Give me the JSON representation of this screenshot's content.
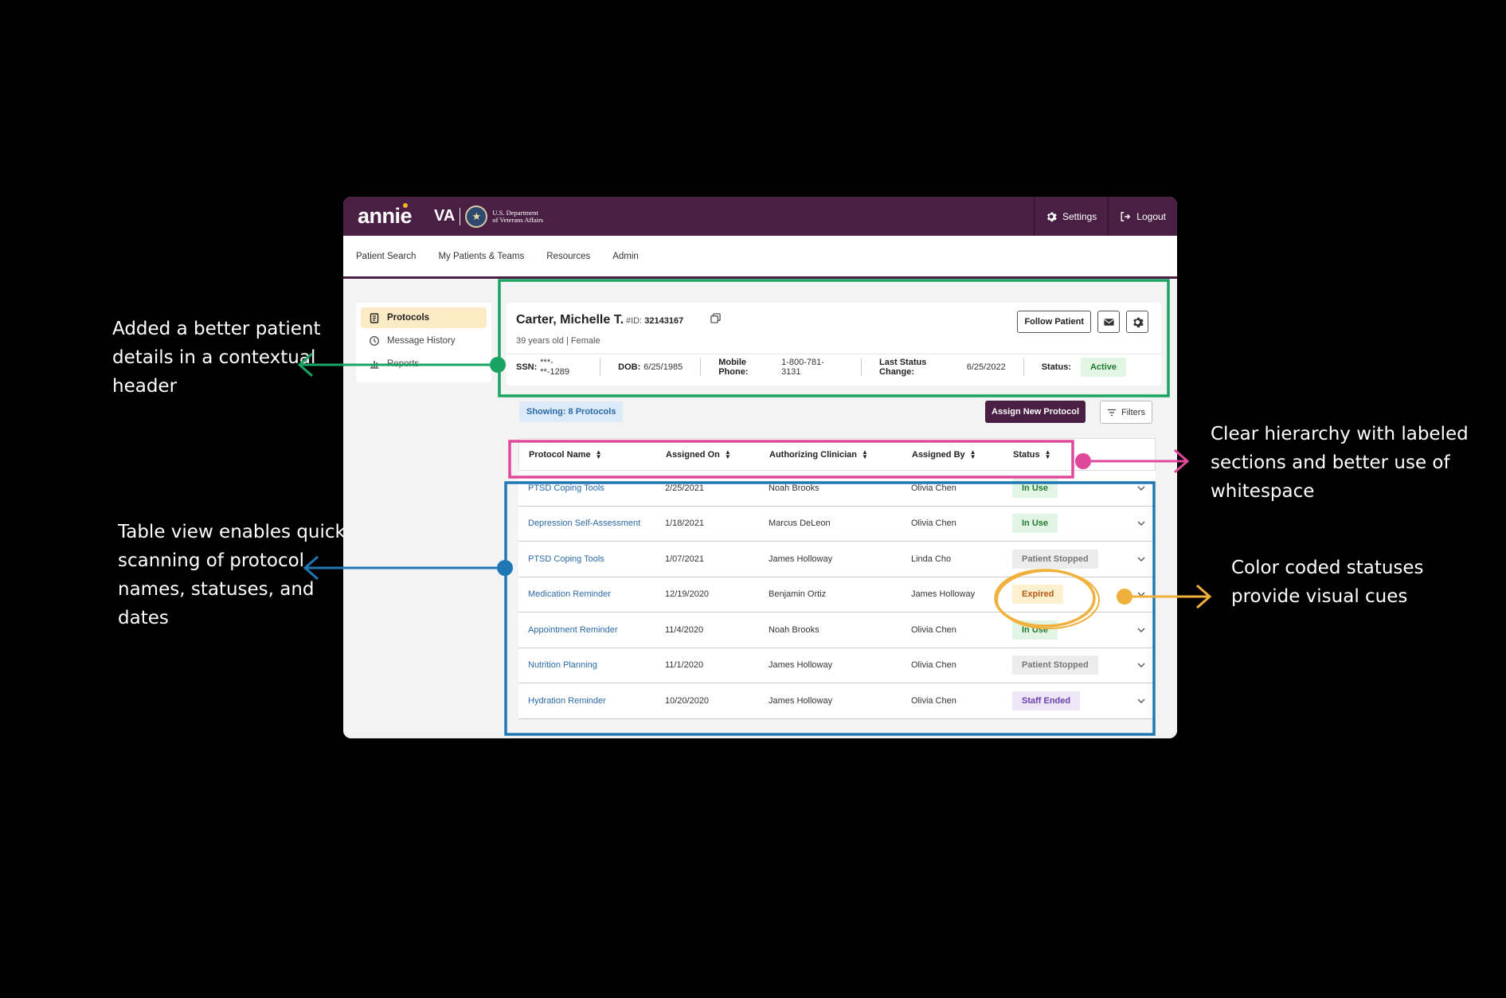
{
  "annotations": {
    "patient_header": "Added a better patient details in a contextual header",
    "table_view": "Table view enables quick scanning of protocol names, statuses, and dates",
    "hierarchy": "Clear hierarchy with labeled sections and better use of whitespace",
    "status_colors": "Color coded statuses provide visual cues"
  },
  "colors": {
    "green": "#1aa463",
    "pink": "#e0489b",
    "blue": "#1f78b4",
    "yellow": "#f0b13c",
    "brand": "#4a1f44"
  },
  "topbar": {
    "logo": "annie",
    "va": "VA",
    "dept_line1": "U.S. Department",
    "dept_line2": "of Veterans Affairs",
    "settings": "Settings",
    "logout": "Logout"
  },
  "nav": {
    "items": [
      "Patient Search",
      "My Patients & Teams",
      "Resources",
      "Admin"
    ]
  },
  "sidebar": {
    "items": [
      {
        "label": "Protocols",
        "icon": "clipboard-icon",
        "active": true
      },
      {
        "label": "Message History",
        "icon": "history-icon",
        "active": false
      },
      {
        "label": "Reports",
        "icon": "chart-icon",
        "active": false
      }
    ]
  },
  "patient": {
    "name": "Carter, Michelle T.",
    "id_label": "#ID:",
    "id_value": "32143167",
    "subtitle": "39 years old | Female",
    "follow_label": "Follow Patient",
    "ssn_label": "SSN:",
    "ssn_value": "***-**-1289",
    "dob_label": "DOB:",
    "dob_value": "6/25/1985",
    "phone_label": "Mobile Phone:",
    "phone_value": "1-800-781-3131",
    "last_change_label": "Last Status Change:",
    "last_change_value": "6/25/2022",
    "status_label": "Status:",
    "status_value": "Active"
  },
  "toolbar": {
    "showing": "Showing: 8 Protocols",
    "assign": "Assign New Protocol",
    "filters": "Filters"
  },
  "table": {
    "headers": [
      "Protocol Name",
      "Assigned On",
      "Authorizing Clinician",
      "Assigned By",
      "Status"
    ],
    "rows": [
      {
        "name": "PTSD Coping Tools",
        "assigned_on": "2/25/2021",
        "clinician": "Noah Brooks",
        "assigned_by": "Olivia Chen",
        "status": "In Use",
        "status_type": "inuse"
      },
      {
        "name": "Depression Self-Assessment",
        "assigned_on": "1/18/2021",
        "clinician": "Marcus DeLeon",
        "assigned_by": "Olivia Chen",
        "status": "In Use",
        "status_type": "inuse"
      },
      {
        "name": "PTSD Coping Tools",
        "assigned_on": "1/07/2021",
        "clinician": "James Holloway",
        "assigned_by": "Linda Cho",
        "status": "Patient Stopped",
        "status_type": "stopped"
      },
      {
        "name": "Medication Reminder",
        "assigned_on": "12/19/2020",
        "clinician": "Benjamin Ortiz",
        "assigned_by": "James Holloway",
        "status": "Expired",
        "status_type": "expired"
      },
      {
        "name": "Appointment Reminder",
        "assigned_on": "11/4/2020",
        "clinician": "Noah Brooks",
        "assigned_by": "Olivia Chen",
        "status": "In Use",
        "status_type": "inuse"
      },
      {
        "name": "Nutrition Planning",
        "assigned_on": "11/1/2020",
        "clinician": "James Holloway",
        "assigned_by": "Olivia Chen",
        "status": "Patient Stopped",
        "status_type": "stopped"
      },
      {
        "name": "Hydration Reminder",
        "assigned_on": "10/20/2020",
        "clinician": "James Holloway",
        "assigned_by": "Olivia Chen",
        "status": "Staff Ended",
        "status_type": "ended"
      }
    ]
  },
  "status_styles": {
    "inuse": {
      "bg": "#e2f4e3",
      "fg": "#1f7a32"
    },
    "stopped": {
      "bg": "#ececec",
      "fg": "#777777"
    },
    "expired": {
      "bg": "#fdf0cf",
      "fg": "#b55a12"
    },
    "ended": {
      "bg": "#ece6f7",
      "fg": "#6a3fb0"
    }
  }
}
